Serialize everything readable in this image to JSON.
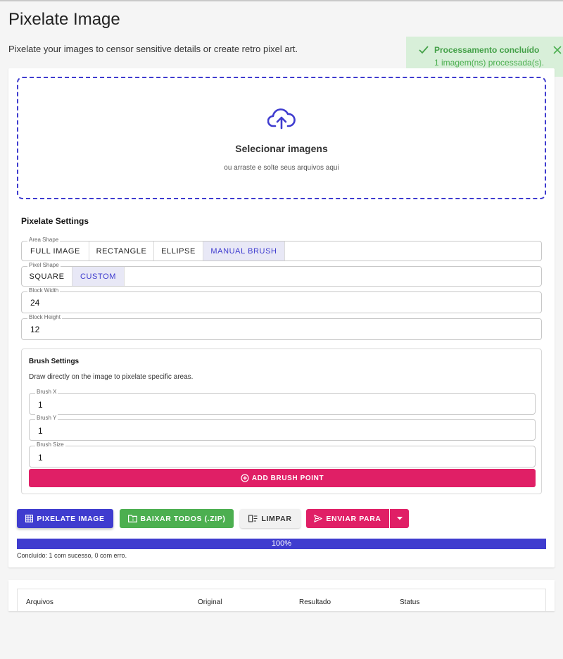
{
  "page": {
    "title": "Pixelate Image",
    "subtitle": "Pixelate your images to censor sensitive details or create retro pixel art."
  },
  "toast": {
    "title": "Processamento concluído",
    "message": "1 imagem(ns) processada(s).",
    "color": "#43a047"
  },
  "dropzone": {
    "title": "Selecionar imagens",
    "subtitle": "ou arraste e solte seus arquivos aqui",
    "icon": "cloud-upload-icon"
  },
  "settings": {
    "title": "Pixelate Settings",
    "area_shape": {
      "label": "Area Shape",
      "options": [
        "FULL IMAGE",
        "RECTANGLE",
        "ELLIPSE",
        "MANUAL BRUSH"
      ],
      "selected": "MANUAL BRUSH"
    },
    "pixel_shape": {
      "label": "Pixel Shape",
      "options": [
        "SQUARE",
        "CUSTOM"
      ],
      "selected": "CUSTOM"
    },
    "block_width": {
      "label": "Block Width",
      "value": "24"
    },
    "block_height": {
      "label": "Block Height",
      "value": "12"
    }
  },
  "brush": {
    "title": "Brush Settings",
    "description": "Draw directly on the image to pixelate specific areas.",
    "brush_x": {
      "label": "Brush X",
      "value": "1"
    },
    "brush_y": {
      "label": "Brush Y",
      "value": "1"
    },
    "brush_size": {
      "label": "Brush Size",
      "value": "1"
    },
    "add_label": "ADD BRUSH POINT"
  },
  "actions": {
    "pixelate": "PIXELATE IMAGE",
    "download": "BAIXAR TODOS (.ZIP)",
    "clear": "LIMPAR",
    "send": "ENVIAR PARA"
  },
  "progress": {
    "percent_label": "100%",
    "value": 1.0,
    "status": "Concluído: 1 com sucesso, 0 com erro."
  },
  "table": {
    "columns": [
      "Arquivos",
      "Original",
      "Resultado",
      "Status"
    ]
  },
  "colors": {
    "primary": "#3f3ccf",
    "accent_pink": "#e01f66",
    "success": "#4caf50"
  }
}
